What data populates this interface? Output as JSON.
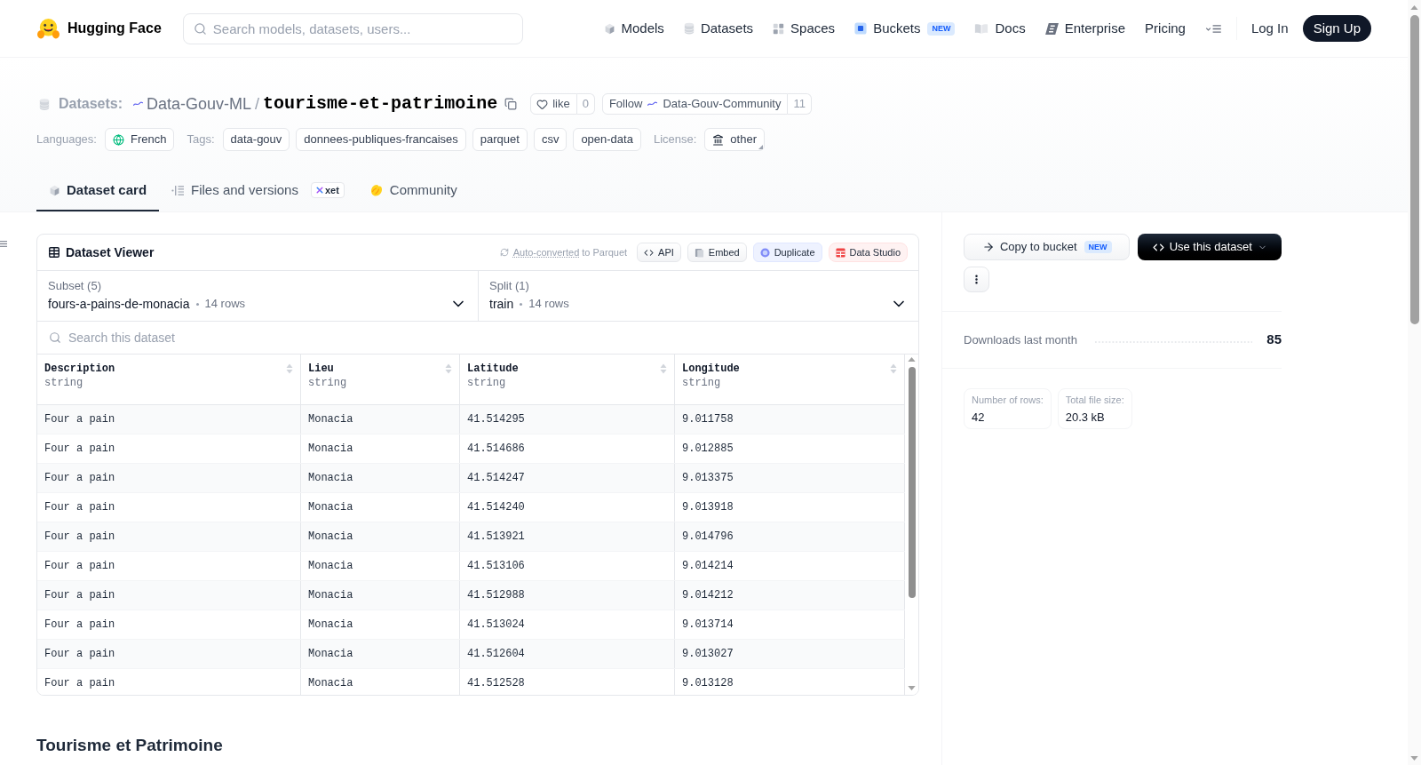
{
  "header": {
    "logo": "Hugging Face",
    "search": {
      "placeholder": "Search models, datasets, users..."
    },
    "nav": [
      {
        "label": "Models"
      },
      {
        "label": "Datasets"
      },
      {
        "label": "Spaces"
      },
      {
        "label": "Buckets",
        "badge": "NEW"
      },
      {
        "label": "Docs"
      },
      {
        "label": "Enterprise"
      },
      {
        "label": "Pricing"
      }
    ],
    "log_in": "Log In",
    "sign_up": "Sign Up"
  },
  "repo": {
    "type_label": "Datasets:",
    "owner": "Data-Gouv-ML",
    "separator": "/",
    "name": "tourisme-et-patrimoine",
    "like": {
      "label": "like",
      "count": "0"
    },
    "follow": {
      "label": "Follow",
      "org": "Data-Gouv-Community",
      "count": "11"
    }
  },
  "metadata": {
    "languages_label": "Languages:",
    "languages": [
      "French"
    ],
    "tags_label": "Tags:",
    "tags": [
      "data-gouv",
      "donnees-publiques-francaises",
      "parquet",
      "csv",
      "open-data"
    ],
    "license_label": "License:",
    "license": "other"
  },
  "tabs": [
    {
      "label": "Dataset card",
      "selected": true
    },
    {
      "label": "Files and versions",
      "selected": false,
      "badge": "xet"
    },
    {
      "label": "Community",
      "selected": false
    }
  ],
  "viewer": {
    "title": "Dataset Viewer",
    "conversion": {
      "link": "Auto-converted",
      "text": "to Parquet"
    },
    "actions": [
      "API",
      "Embed",
      "Duplicate",
      "Data Studio"
    ],
    "subset": {
      "label": "Subset (5)",
      "value": "fours-a-pains-de-monacia",
      "rows": "14 rows"
    },
    "split": {
      "label": "Split (1)",
      "value": "train",
      "rows": "14 rows"
    },
    "search": {
      "placeholder": "Search this dataset"
    },
    "columns": [
      {
        "name": "Description",
        "type": "string"
      },
      {
        "name": "Lieu",
        "type": "string"
      },
      {
        "name": "Latitude",
        "type": "string"
      },
      {
        "name": "Longitude",
        "type": "string"
      }
    ],
    "rows": [
      [
        "Four a pain",
        "Monacia",
        "41.514295",
        "9.011758"
      ],
      [
        "Four a pain",
        "Monacia",
        "41.514686",
        "9.012885"
      ],
      [
        "Four a pain",
        "Monacia",
        "41.514247",
        "9.013375"
      ],
      [
        "Four a pain",
        "Monacia",
        "41.514240",
        "9.013918"
      ],
      [
        "Four a pain",
        "Monacia",
        "41.513921",
        "9.014796"
      ],
      [
        "Four a pain",
        "Monacia",
        "41.513106",
        "9.014214"
      ],
      [
        "Four a pain",
        "Monacia",
        "41.512988",
        "9.014212"
      ],
      [
        "Four a pain",
        "Monacia",
        "41.513024",
        "9.013714"
      ],
      [
        "Four a pain",
        "Monacia",
        "41.512604",
        "9.013027"
      ],
      [
        "Four a pain",
        "Monacia",
        "41.512528",
        "9.013128"
      ]
    ]
  },
  "sidebar": {
    "copy_button": {
      "label": "Copy to bucket",
      "badge": "NEW"
    },
    "use_button": "Use this dataset",
    "downloads": {
      "label": "Downloads last month",
      "value": "85"
    },
    "stats": [
      {
        "label": "Number of rows:",
        "value": "42"
      },
      {
        "label": "Total file size:",
        "value": "20.3 kB"
      }
    ]
  },
  "card": {
    "heading": "Tourisme et Patrimoine"
  }
}
